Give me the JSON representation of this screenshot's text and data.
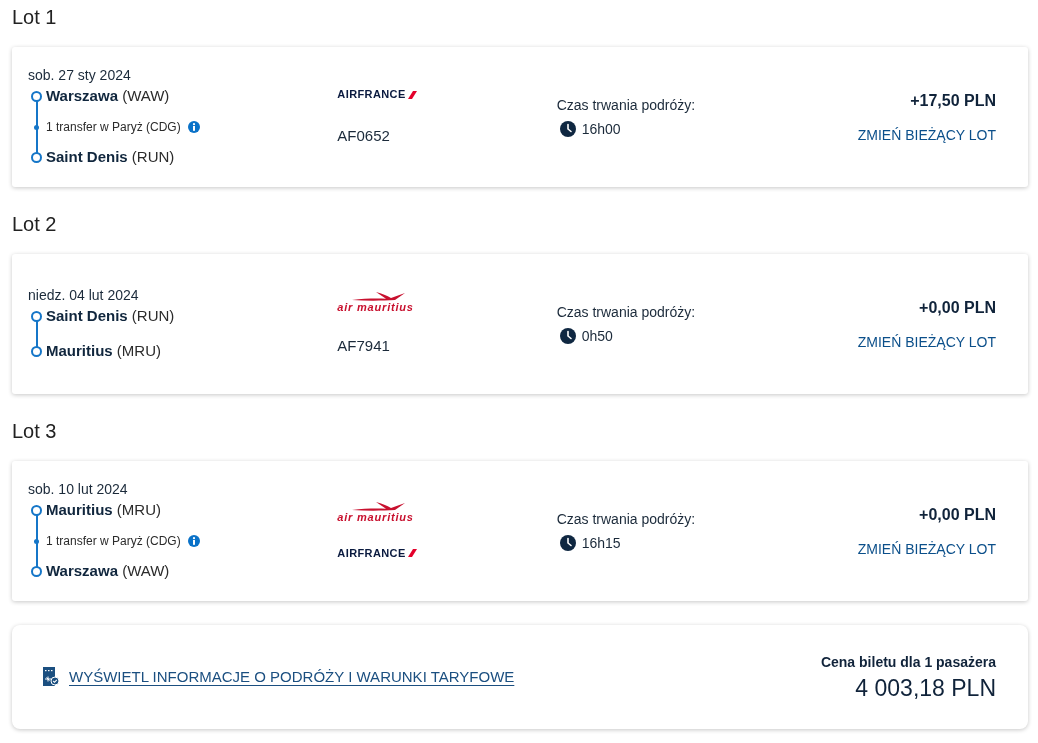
{
  "flights": [
    {
      "heading": "Lot 1",
      "date": "sob. 27 sty 2024",
      "stops": [
        {
          "kind": "airport",
          "city": "Warszawa",
          "code": "(WAW)"
        },
        {
          "kind": "transfer",
          "text": "1 transfer w Paryż (CDG)"
        },
        {
          "kind": "airport",
          "city": "Saint Denis",
          "code": "(RUN)"
        }
      ],
      "airlines": [
        {
          "kind": "airfrance",
          "name": "AIRFRANCE"
        }
      ],
      "flight_number": "AF0652",
      "duration_label": "Czas trwania podróży:",
      "duration": "16h00",
      "price_change": "+17,50 PLN",
      "change_button": "ZMIEŃ BIEŻĄCY LOT"
    },
    {
      "heading": "Lot 2",
      "date": "niedz. 04 lut 2024",
      "stops": [
        {
          "kind": "airport",
          "city": "Saint Denis",
          "code": "(RUN)"
        },
        {
          "kind": "airport",
          "city": "Mauritius",
          "code": "(MRU)"
        }
      ],
      "airlines": [
        {
          "kind": "airmauritius",
          "name": "air mauritius"
        }
      ],
      "flight_number": "AF7941",
      "duration_label": "Czas trwania podróży:",
      "duration": "0h50",
      "price_change": "+0,00 PLN",
      "change_button": "ZMIEŃ BIEŻĄCY LOT"
    },
    {
      "heading": "Lot 3",
      "date": "sob. 10 lut 2024",
      "stops": [
        {
          "kind": "airport",
          "city": "Mauritius",
          "code": "(MRU)"
        },
        {
          "kind": "transfer",
          "text": "1 transfer w Paryż (CDG)"
        },
        {
          "kind": "airport",
          "city": "Warszawa",
          "code": "(WAW)"
        }
      ],
      "airlines": [
        {
          "kind": "airmauritius",
          "name": "air mauritius"
        },
        {
          "kind": "airfrance",
          "name": "AIRFRANCE"
        }
      ],
      "duration_label": "Czas trwania podróży:",
      "duration": "16h15",
      "price_change": "+0,00 PLN",
      "change_button": "ZMIEŃ BIEŻĄCY LOT"
    }
  ],
  "summary": {
    "link": "WYŚWIETL INFORMACJE O PODRÓŻY I WARUNKI TARYFOWE",
    "price_label": "Cena biletu dla 1 pasażera",
    "price": "4 003,18 PLN"
  }
}
